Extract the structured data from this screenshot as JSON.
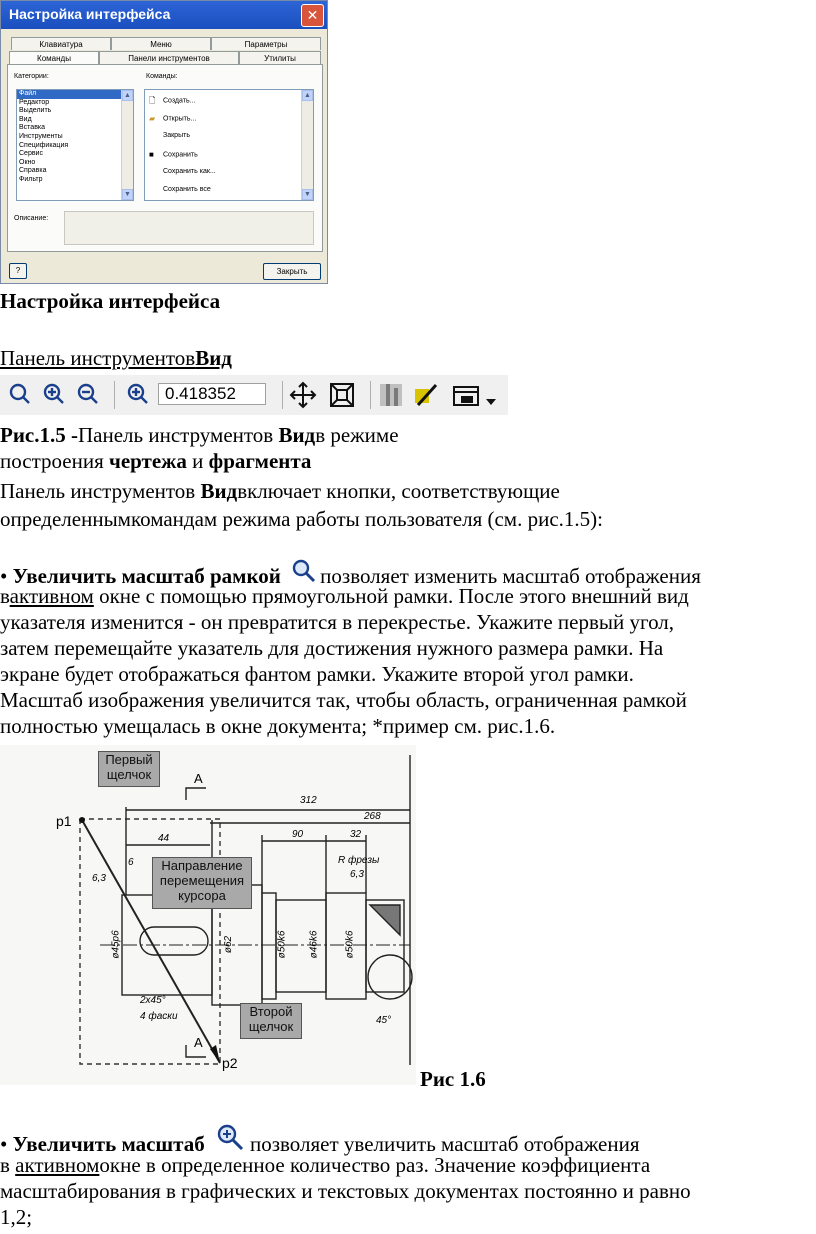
{
  "dialog": {
    "title": "Настройка интерфейса",
    "close_glyph": "✕",
    "tabs_row1": [
      "Клавиатура",
      "Меню",
      "Параметры"
    ],
    "tabs_row2": [
      "Команды",
      "Панели инструментов",
      "Утилиты"
    ],
    "categories_label": "Категории:",
    "commands_label": "Команды:",
    "categories": [
      "Файл",
      "Редактор",
      "Выделить",
      "Вид",
      "Вставка",
      "Инструменты",
      "Спецификация",
      "Сервис",
      "Окно",
      "Справка",
      "Фильтр"
    ],
    "selected_category": "Файл",
    "commands": [
      "Создать...",
      "Открыть...",
      "Закрыть",
      "Сохранить",
      "Сохранить как...",
      "Сохранить все"
    ],
    "description_label": "Описание:",
    "close_button": "Закрыть"
  },
  "caption1": "Настройка интерфейса",
  "heading": {
    "part1": "Панель инструментов",
    "part2": "Вид"
  },
  "toolbar": {
    "zoom_value": "0.418352"
  },
  "fig15": {
    "label": "Рис.1.5",
    "sep": " -",
    "t1": "Панель инструментов ",
    "b1": "Вид",
    "t2": "в режиме",
    "t3": "построения ",
    "b2": "чертежа",
    "t4": " и ",
    "b3": "фрагмента"
  },
  "para1": {
    "t1": "Панель инструментов ",
    "b1": "Вид",
    "t2": "включает кнопки, соответствующие",
    "line2": "определеннымкомандам режима работы пользователя (см. рис.1.5):"
  },
  "bullet1": {
    "bullet": "•",
    "title": "Увеличить масштаб рамкой",
    "t1": "позволяет изменить масштаб отображения",
    "l2a": "в",
    "l2u": "активном",
    "l2b": " окне с помощью прямоугольной рамки. После этого внешний вид",
    "l3": "указателя изменится - он превратится в перекрестье. Укажите первый угол,",
    "l4": "затем перемещайте указатель для достижения нужного размера рамки. На",
    "l5": "экране будет отображаться фантом рамки. Укажите второй угол рамки.",
    "l6": "Масштаб изображения увеличится так, чтобы область, ограниченная рамкой",
    "l7": "полностью умещалась в окне документа; *пример см. рис.1.6."
  },
  "drawing": {
    "callout1": [
      "Первый",
      "щелчок"
    ],
    "callout2": [
      "Направление",
      "перемещения",
      "курсора"
    ],
    "callout3": [
      "Второй",
      "щелчок"
    ],
    "p1": "p1",
    "p2": "p2",
    "section_mark": "A",
    "dims": [
      "312",
      "268",
      "90",
      "32",
      "44",
      "6",
      "6,3",
      "R фрезы",
      "6,3",
      "45°",
      "2x45°",
      "4 фаски",
      "ø45p6",
      "ø62",
      "ø50k6",
      "ø46k6",
      "ø50k6"
    ]
  },
  "fig16": "Рис 1.6",
  "bullet2": {
    "bullet": "•",
    "title": "Увеличить масштаб",
    "t1": "позволяет увеличить масштаб отображения",
    "l2a": "в ",
    "l2u": "активном",
    "l2b": "окне в определенное количество раз. Значение коэффициента",
    "l3": "масштабирования в графических и текстовых документах постоянно и равно",
    "l4": "1,2;"
  }
}
